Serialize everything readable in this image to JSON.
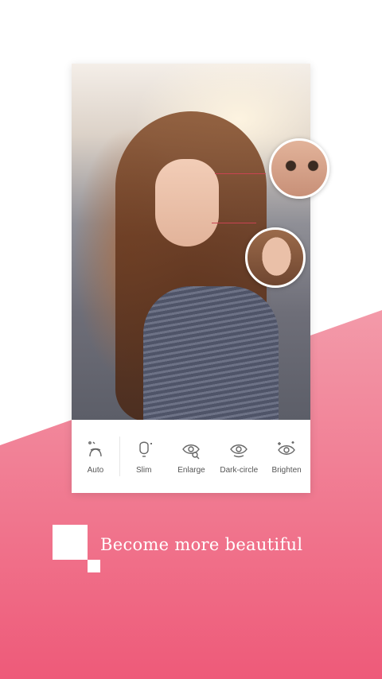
{
  "colors": {
    "pink_top": "#f28a9c",
    "pink_bottom": "#ee5a79",
    "accent": "#c94352"
  },
  "photo": {
    "alt": "portrait photo",
    "zoom_eye_icon": "eye-zoom-preview",
    "zoom_face_icon": "face-zoom-preview"
  },
  "toolbar": {
    "items": [
      {
        "label": "Auto",
        "icon": "auto-face-icon"
      },
      {
        "label": "Slim",
        "icon": "slim-face-icon"
      },
      {
        "label": "Enlarge",
        "icon": "enlarge-eye-icon"
      },
      {
        "label": "Dark-circle",
        "icon": "dark-circle-eye-icon"
      },
      {
        "label": "Brighten",
        "icon": "brighten-eye-icon"
      }
    ]
  },
  "tagline": "Become more beautiful"
}
